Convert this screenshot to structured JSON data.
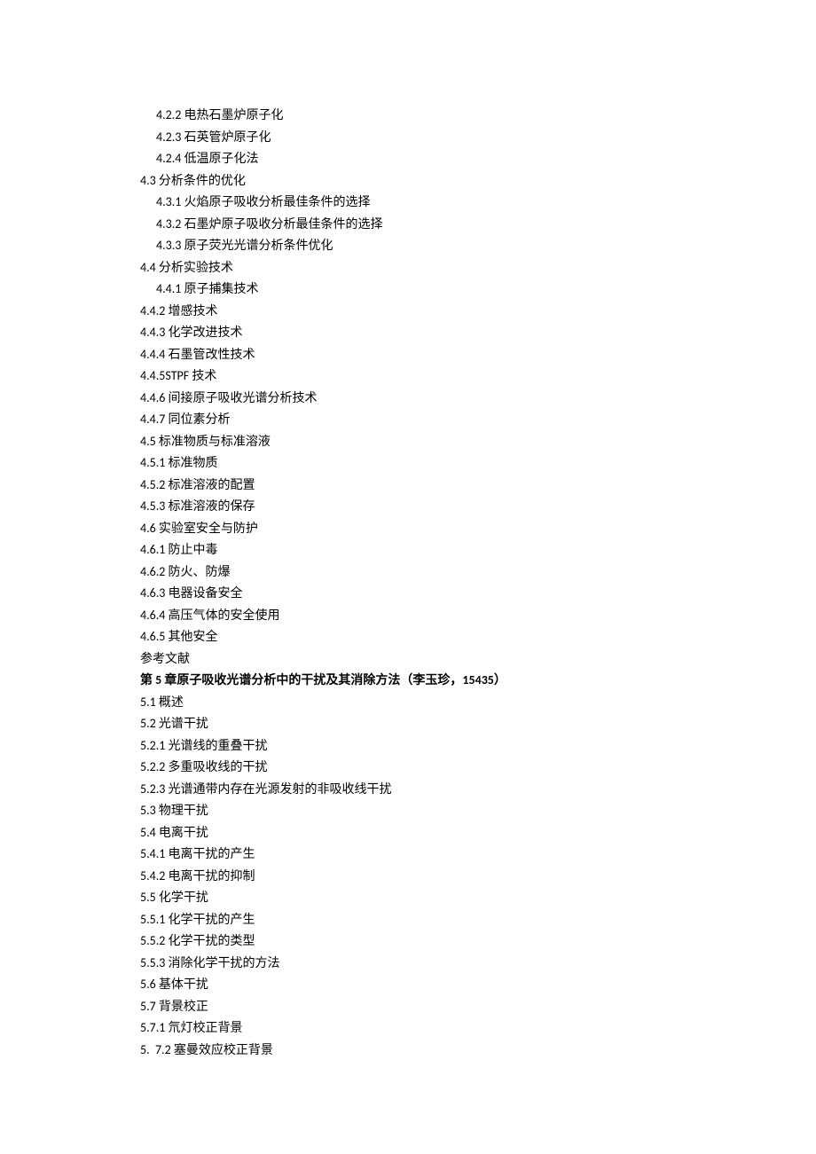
{
  "lines": [
    {
      "indent": "indent-2",
      "bold": false,
      "text": "4.2.2 电热石墨炉原子化"
    },
    {
      "indent": "indent-2",
      "bold": false,
      "text": "4.2.3 石英管炉原子化"
    },
    {
      "indent": "indent-2",
      "bold": false,
      "text": "4.2.4 低温原子化法"
    },
    {
      "indent": "indent-1",
      "bold": false,
      "text": "4.3 分析条件的优化"
    },
    {
      "indent": "indent-2",
      "bold": false,
      "text": "4.3.1 火焰原子吸收分析最佳条件的选择"
    },
    {
      "indent": "indent-2",
      "bold": false,
      "text": "4.3.2 石墨炉原子吸收分析最佳条件的选择"
    },
    {
      "indent": "indent-2",
      "bold": false,
      "text": "4.3.3 原子荧光光谱分析条件优化"
    },
    {
      "indent": "indent-1",
      "bold": false,
      "text": "4.4 分析实验技术"
    },
    {
      "indent": "indent-2",
      "bold": false,
      "text": "4.4.1 原子捕集技术"
    },
    {
      "indent": "indent-1",
      "bold": false,
      "text": "4.4.2 增感技术"
    },
    {
      "indent": "indent-1",
      "bold": false,
      "text": "4.4.3 化学改进技术"
    },
    {
      "indent": "indent-1",
      "bold": false,
      "text": "4.4.4 石墨管改性技术"
    },
    {
      "indent": "indent-1",
      "bold": false,
      "text": "4.4.5STPF 技术"
    },
    {
      "indent": "indent-1",
      "bold": false,
      "text": "4.4.6 间接原子吸收光谱分析技术"
    },
    {
      "indent": "indent-1",
      "bold": false,
      "text": "4.4.7 同位素分析"
    },
    {
      "indent": "indent-1",
      "bold": false,
      "text": "4.5 标准物质与标准溶液"
    },
    {
      "indent": "indent-1",
      "bold": false,
      "text": "4.5.1 标准物质"
    },
    {
      "indent": "indent-1",
      "bold": false,
      "text": "4.5.2 标准溶液的配置"
    },
    {
      "indent": "indent-1",
      "bold": false,
      "text": "4.5.3 标准溶液的保存"
    },
    {
      "indent": "indent-1",
      "bold": false,
      "text": "4.6 实验室安全与防护"
    },
    {
      "indent": "indent-1",
      "bold": false,
      "text": "4.6.1 防止中毒"
    },
    {
      "indent": "indent-1",
      "bold": false,
      "text": "4.6.2 防火、防爆"
    },
    {
      "indent": "indent-1",
      "bold": false,
      "text": "4.6.3 电器设备安全"
    },
    {
      "indent": "indent-1",
      "bold": false,
      "text": "4.6.4 高压气体的安全使用"
    },
    {
      "indent": "indent-1",
      "bold": false,
      "text": "4.6.5 其他安全"
    },
    {
      "indent": "indent-1",
      "bold": false,
      "text": "参考文献"
    },
    {
      "indent": "indent-1",
      "bold": true,
      "text": "第 5 章原子吸收光谱分析中的干扰及其消除方法（李玉珍，15435）"
    },
    {
      "indent": "indent-1",
      "bold": false,
      "text": "5.1 概述"
    },
    {
      "indent": "indent-1",
      "bold": false,
      "text": "5.2 光谱干扰"
    },
    {
      "indent": "indent-1",
      "bold": false,
      "text": "5.2.1 光谱线的重叠干扰"
    },
    {
      "indent": "indent-1",
      "bold": false,
      "text": "5.2.2 多重吸收线的干扰"
    },
    {
      "indent": "indent-1",
      "bold": false,
      "text": "5.2.3 光谱通带内存在光源发射的非吸收线干扰"
    },
    {
      "indent": "indent-1",
      "bold": false,
      "text": "5.3 物理干扰"
    },
    {
      "indent": "indent-1",
      "bold": false,
      "text": "5.4 电离干扰"
    },
    {
      "indent": "indent-1",
      "bold": false,
      "text": "5.4.1 电离干扰的产生"
    },
    {
      "indent": "indent-1",
      "bold": false,
      "text": "5.4.2 电离干扰的抑制"
    },
    {
      "indent": "indent-1",
      "bold": false,
      "text": "5.5 化学干扰"
    },
    {
      "indent": "indent-1",
      "bold": false,
      "text": "5.5.1 化学干扰的产生"
    },
    {
      "indent": "indent-1",
      "bold": false,
      "text": "5.5.2 化学干扰的类型"
    },
    {
      "indent": "indent-1",
      "bold": false,
      "text": "5.5.3 消除化学干扰的方法"
    },
    {
      "indent": "indent-1",
      "bold": false,
      "text": "5.6 基体干扰"
    },
    {
      "indent": "indent-1",
      "bold": false,
      "text": "5.7 背景校正"
    },
    {
      "indent": "indent-1",
      "bold": false,
      "text": "5.7.1 氘灯校正背景"
    },
    {
      "indent": "indent-1",
      "bold": false,
      "text": "5.  7.2 塞曼效应校正背景"
    }
  ]
}
